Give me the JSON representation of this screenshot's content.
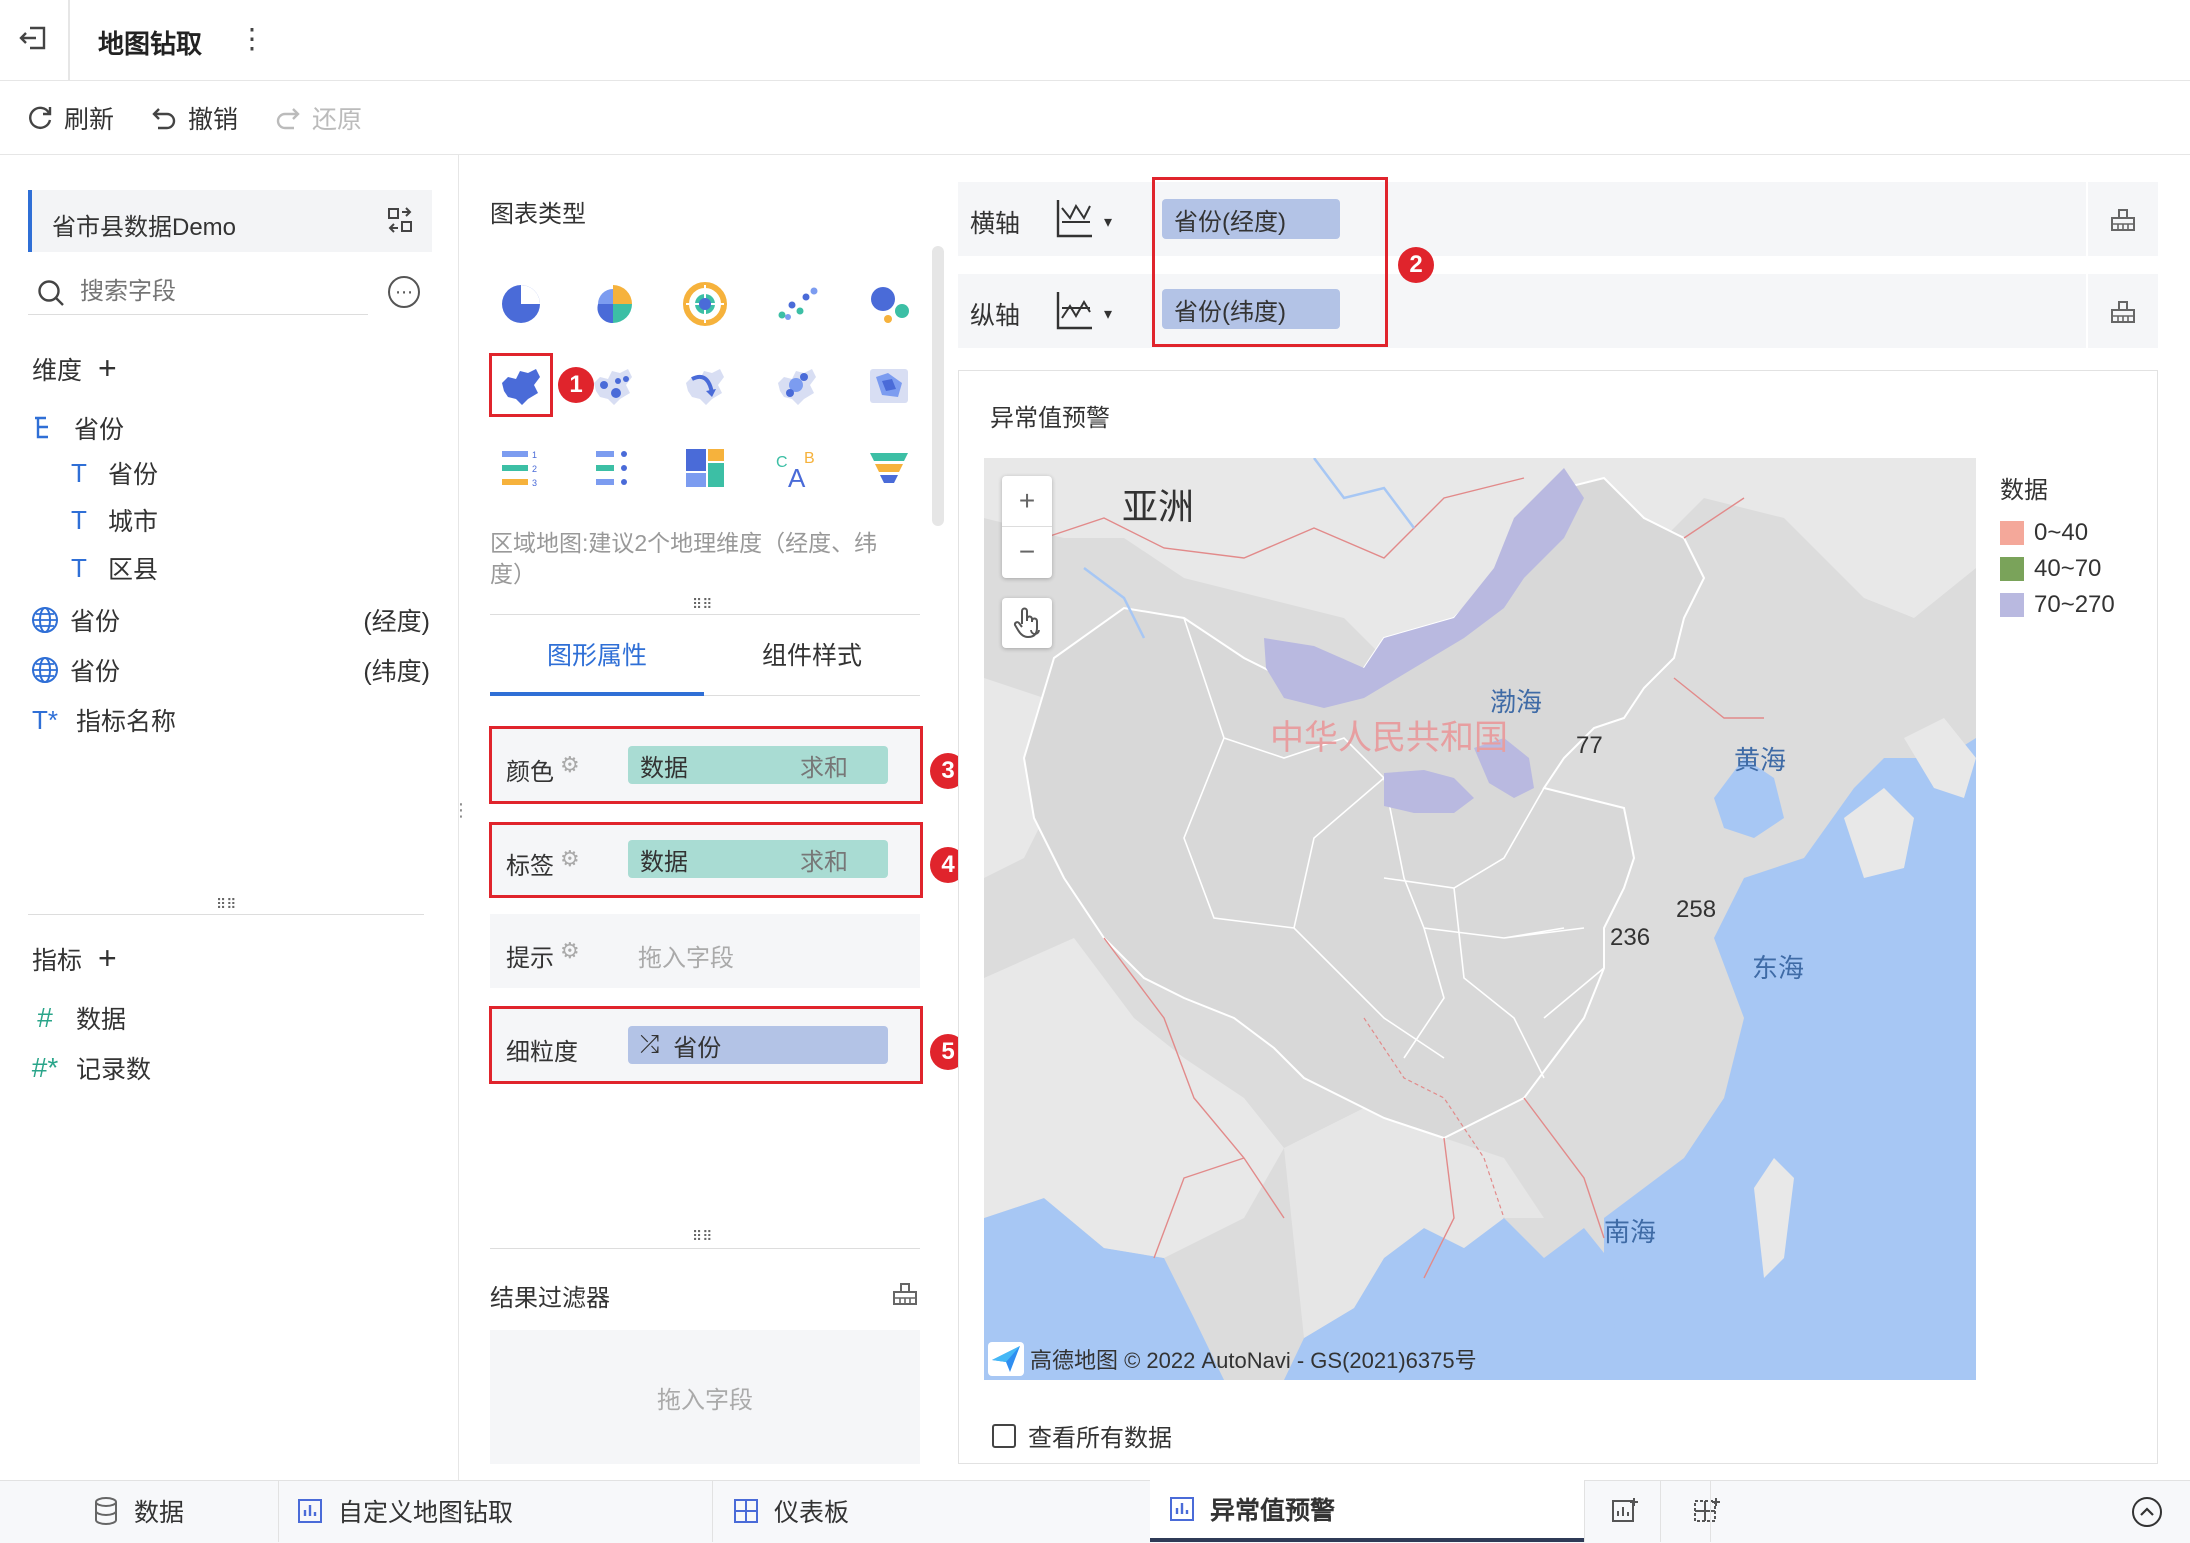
{
  "header": {
    "title": "地图钻取"
  },
  "toolbar": {
    "refresh": "刷新",
    "undo": "撤销",
    "redo": "还原"
  },
  "dataset": {
    "name": "省市县数据Demo",
    "search_placeholder": "搜索字段"
  },
  "dimensions": {
    "title": "维度",
    "items": [
      {
        "label": "省份"
      },
      {
        "label": "省份"
      },
      {
        "label": "城市"
      },
      {
        "label": "区县"
      }
    ],
    "geo": [
      {
        "label": "省份",
        "suffix": "(经度)"
      },
      {
        "label": "省份",
        "suffix": "(纬度)"
      }
    ],
    "metric_name": "指标名称"
  },
  "metrics": {
    "title": "指标",
    "items": [
      {
        "label": "数据"
      },
      {
        "label": "记录数"
      }
    ]
  },
  "chart_panel": {
    "title": "图表类型",
    "hint": "区域地图:建议2个地理维度（经度、纬度）",
    "tabs": {
      "graphic": "图形属性",
      "component": "组件样式"
    },
    "color": {
      "label": "颜色",
      "field": "数据",
      "agg": "求和"
    },
    "label": {
      "label": "标签",
      "field": "数据",
      "agg": "求和"
    },
    "tooltip": {
      "label": "提示",
      "placeholder": "拖入字段"
    },
    "granularity": {
      "label": "细粒度",
      "field": "省份"
    },
    "filter": {
      "title": "结果过滤器",
      "placeholder": "拖入字段"
    }
  },
  "axes": {
    "x": {
      "label": "横轴",
      "field": "省份(经度)"
    },
    "y": {
      "label": "纵轴",
      "field": "省份(纬度)"
    }
  },
  "badges": [
    "1",
    "2",
    "3",
    "4",
    "5"
  ],
  "chart": {
    "title": "异常值预警",
    "map_labels": {
      "continent": "亚洲",
      "country": "中华人民共和国",
      "bohai": "渤海",
      "yellow_sea": "黄海",
      "east_sea": "东海",
      "south_sea": "南海"
    },
    "attribution": "高德地图 © 2022 AutoNavi - GS(2021)6375号",
    "zoom_in": "+",
    "zoom_out": "−",
    "show_all": "查看所有数据",
    "values": [
      "77",
      "258",
      "236"
    ],
    "legend": {
      "title": "数据",
      "items": [
        {
          "label": "0~40",
          "color": "#f4a89a"
        },
        {
          "label": "40~70",
          "color": "#7aa35a"
        },
        {
          "label": "70~270",
          "color": "#b9b9e0"
        }
      ]
    }
  },
  "bottom_tabs": {
    "data": "数据",
    "custom": "自定义地图钻取",
    "dashboard": "仪表板",
    "alert": "异常值预警"
  }
}
